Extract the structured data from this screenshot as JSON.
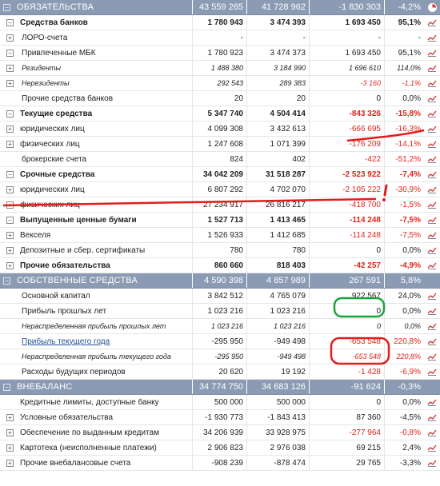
{
  "rows": [
    {
      "label": "ОБЯЗАТЕЛЬСТВА",
      "v1": "43 559 265",
      "v2": "41 728 962",
      "v3": "-1 830 303",
      "v4": "-4,2%",
      "type": "sec",
      "expand": "minus",
      "icon": "pie",
      "neg": [
        true,
        true
      ]
    },
    {
      "label": "Средства банков",
      "v1": "1 780 943",
      "v2": "3 474 393",
      "v3": "1 693 450",
      "v4": "95,1%",
      "type": "bold",
      "expand": "minus",
      "icon": "chart",
      "indent": 0,
      "neg": [
        false,
        false
      ]
    },
    {
      "label": "ЛОРО-счета",
      "v1": "-",
      "v2": "-",
      "v3": "-",
      "v4": "-",
      "type": "normal",
      "expand": "plus",
      "icon": "chart",
      "indent": 1,
      "neg": [
        false,
        false
      ]
    },
    {
      "label": "Привлеченные МБК",
      "v1": "1 780 923",
      "v2": "3 474 373",
      "v3": "1 693 450",
      "v4": "95,1%",
      "type": "normal",
      "expand": "minus",
      "icon": "chart",
      "indent": 1,
      "neg": [
        false,
        false
      ]
    },
    {
      "label": "Резиденты",
      "v1": "1 488 380",
      "v2": "3 184 990",
      "v3": "1 696 610",
      "v4": "114,0%",
      "type": "it",
      "expand": "plus",
      "icon": "chart",
      "indent": 1,
      "neg": [
        false,
        false
      ]
    },
    {
      "label": "Нерезиденты",
      "v1": "292 543",
      "v2": "289 383",
      "v3": "-3 160",
      "v4": "-1,1%",
      "type": "it",
      "expand": "plus",
      "icon": "chart",
      "indent": 1,
      "neg": [
        true,
        true
      ]
    },
    {
      "label": "Прочие средства банков",
      "v1": "20",
      "v2": "20",
      "v3": "0",
      "v4": "0,0%",
      "type": "normal",
      "expand": "",
      "icon": "chart",
      "indent": 1,
      "neg": [
        false,
        false
      ]
    },
    {
      "label": "Текущие средства",
      "v1": "5 347 740",
      "v2": "4 504 414",
      "v3": "-843 326",
      "v4": "-15,8%",
      "type": "bold",
      "expand": "minus",
      "icon": "chart",
      "indent": 0,
      "neg": [
        true,
        true
      ]
    },
    {
      "label": "юридических лиц",
      "v1": "4 099 308",
      "v2": "3 432 613",
      "v3": "-666 695",
      "v4": "-16,3%",
      "type": "normal",
      "expand": "plus",
      "icon": "chart",
      "indent": 0,
      "neg": [
        true,
        true
      ]
    },
    {
      "label": "физических лиц",
      "v1": "1 247 608",
      "v2": "1 071 399",
      "v3": "-176 209",
      "v4": "-14,1%",
      "type": "normal",
      "expand": "plus",
      "icon": "chart",
      "indent": 0,
      "neg": [
        true,
        true
      ]
    },
    {
      "label": "брокерские счета",
      "v1": "824",
      "v2": "402",
      "v3": "-422",
      "v4": "-51,2%",
      "type": "normal",
      "expand": "",
      "icon": "chart",
      "indent": 1,
      "neg": [
        true,
        true
      ]
    },
    {
      "label": "Срочные средства",
      "v1": "34 042 209",
      "v2": "31 518 287",
      "v3": "-2 523 922",
      "v4": "-7,4%",
      "type": "bold",
      "expand": "minus",
      "icon": "chart",
      "indent": 0,
      "neg": [
        true,
        true
      ]
    },
    {
      "label": "юридических лиц",
      "v1": "6 807 292",
      "v2": "4 702 070",
      "v3": "-2 105 222",
      "v4": "-30,9%",
      "type": "normal",
      "expand": "plus",
      "icon": "chart",
      "indent": 0,
      "neg": [
        true,
        true
      ]
    },
    {
      "label": "физических лиц",
      "v1": "27 234 917",
      "v2": "26 816 217",
      "v3": "-418 700",
      "v4": "-1,5%",
      "type": "normal",
      "expand": "plus",
      "icon": "chart",
      "indent": 0,
      "neg": [
        true,
        true
      ]
    },
    {
      "label": "Выпущенные ценные бумаги",
      "v1": "1 527 713",
      "v2": "1 413 465",
      "v3": "-114 248",
      "v4": "-7,5%",
      "type": "bold",
      "expand": "minus",
      "icon": "chart",
      "indent": 0,
      "neg": [
        true,
        true
      ]
    },
    {
      "label": "Векселя",
      "v1": "1 526 933",
      "v2": "1 412 685",
      "v3": "-114 248",
      "v4": "-7,5%",
      "type": "normal",
      "expand": "plus",
      "icon": "chart",
      "indent": 0,
      "neg": [
        true,
        true
      ]
    },
    {
      "label": "Депозитные и сбер. сертификаты",
      "v1": "780",
      "v2": "780",
      "v3": "0",
      "v4": "0,0%",
      "type": "normal",
      "expand": "plus",
      "icon": "chart",
      "indent": 0,
      "neg": [
        false,
        false
      ]
    },
    {
      "label": "Прочие обязательства",
      "v1": "860 660",
      "v2": "818 403",
      "v3": "-42 257",
      "v4": "-4,9%",
      "type": "bold",
      "expand": "plus",
      "icon": "chart",
      "indent": 0,
      "neg": [
        true,
        true
      ]
    },
    {
      "label": "СОБСТВЕННЫЕ СРЕДСТВА",
      "v1": "4 590 398",
      "v2": "4 857 989",
      "v3": "267 591",
      "v4": "5,8%",
      "type": "sec",
      "expand": "minus",
      "icon": "none",
      "neg": [
        false,
        false
      ]
    },
    {
      "label": "Основной капитал",
      "v1": "3 842 512",
      "v2": "4 765 079",
      "v3": "922 567",
      "v4": "24,0%",
      "type": "normal",
      "expand": "",
      "icon": "chart",
      "indent": 1,
      "neg": [
        false,
        false
      ]
    },
    {
      "label": "Прибыль прошлых лет",
      "v1": "1 023 216",
      "v2": "1 023 216",
      "v3": "0",
      "v4": "0,0%",
      "type": "normal",
      "expand": "",
      "icon": "chart",
      "indent": 1,
      "neg": [
        false,
        false
      ]
    },
    {
      "label": "Нераспределенная прибыль прошлых лет",
      "v1": "1 023 216",
      "v2": "1 023 216",
      "v3": "0",
      "v4": "0,0%",
      "type": "it",
      "expand": "",
      "icon": "chart",
      "indent": 1,
      "neg": [
        false,
        false
      ]
    },
    {
      "label": "Прибыль текущего года",
      "v1": "-295 950",
      "v2": "-949 498",
      "v3": "-653 548",
      "v4": "220,8%",
      "type": "link",
      "expand": "",
      "icon": "chart",
      "indent": 1,
      "neg": [
        true,
        true
      ]
    },
    {
      "label": "Нераспределенная прибыль текущего года",
      "v1": "-295 950",
      "v2": "-949 498",
      "v3": "-653 548",
      "v4": "220,8%",
      "type": "it",
      "expand": "",
      "icon": "chart",
      "indent": 1,
      "neg": [
        true,
        true
      ]
    },
    {
      "label": "Расходы будущих периодов",
      "v1": "20 620",
      "v2": "19 192",
      "v3": "-1 428",
      "v4": "-6,9%",
      "type": "normal",
      "expand": "",
      "icon": "chart",
      "indent": 1,
      "neg": [
        true,
        true
      ]
    },
    {
      "label": "ВНЕБАЛАНС",
      "v1": "34 774 750",
      "v2": "34 683 126",
      "v3": "-91 624",
      "v4": "-0,3%",
      "type": "sec",
      "expand": "minus",
      "icon": "none",
      "neg": [
        false,
        false
      ]
    },
    {
      "label": "Кредитные лимиты, доступные банку",
      "v1": "500 000",
      "v2": "500 000",
      "v3": "0",
      "v4": "0,0%",
      "type": "normal",
      "expand": "",
      "icon": "chart",
      "indent": 0,
      "neg": [
        false,
        false
      ]
    },
    {
      "label": "Условные обязательства",
      "v1": "-1 930 773",
      "v2": "-1 843 413",
      "v3": "87 360",
      "v4": "-4,5%",
      "type": "normal",
      "expand": "plus",
      "icon": "chart",
      "indent": 0,
      "neg": [
        false,
        false
      ]
    },
    {
      "label": "Обеспечение по выданным кредитам",
      "v1": "34 206 939",
      "v2": "33 928 975",
      "v3": "-277 964",
      "v4": "-0,8%",
      "type": "normal",
      "expand": "plus",
      "icon": "chart",
      "indent": 0,
      "neg": [
        true,
        true
      ]
    },
    {
      "label": "Картотека (неисполненные платежи)",
      "v1": "2 906 823",
      "v2": "2 976 038",
      "v3": "69 215",
      "v4": "2,4%",
      "type": "normal",
      "expand": "plus",
      "icon": "chart",
      "indent": 0,
      "neg": [
        false,
        false
      ]
    },
    {
      "label": "Прочие внебалансовые счета",
      "v1": "-908 239",
      "v2": "-878 474",
      "v3": "29 765",
      "v4": "-3,3%",
      "type": "normal",
      "expand": "plus",
      "icon": "chart",
      "indent": 0,
      "neg": [
        false,
        false
      ]
    }
  ],
  "colors": {
    "header_bg": "#8a9bb3",
    "negative": "#e0241b",
    "link": "#1f4f8f",
    "annotation_red": "#e31b1b",
    "annotation_green": "#1aa23a"
  }
}
